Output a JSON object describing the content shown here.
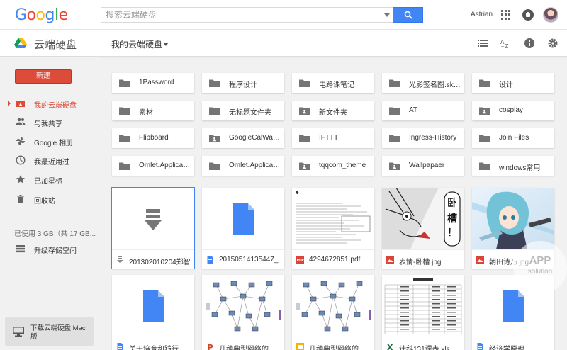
{
  "header": {
    "logo_letters": [
      {
        "ch": "G",
        "color": "#4285f4"
      },
      {
        "ch": "o",
        "color": "#ea4335"
      },
      {
        "ch": "o",
        "color": "#fbbc05"
      },
      {
        "ch": "g",
        "color": "#4285f4"
      },
      {
        "ch": "l",
        "color": "#34a853"
      },
      {
        "ch": "e",
        "color": "#ea4335"
      }
    ],
    "search_placeholder": "搜索云端硬盘",
    "user_name": "Astrian"
  },
  "subbar": {
    "app_title": "云端硬盘",
    "breadcrumb": "我的云端硬盘"
  },
  "sidebar": {
    "new_label": "新建",
    "items": [
      {
        "label": "我的云端硬盘",
        "icon": "drive-icon",
        "active": true
      },
      {
        "label": "与我共享",
        "icon": "people-icon",
        "active": false
      },
      {
        "label": "Google 相册",
        "icon": "photos-icon",
        "active": false
      },
      {
        "label": "我最近用过",
        "icon": "clock-icon",
        "active": false
      },
      {
        "label": "已加星标",
        "icon": "star-icon",
        "active": false
      },
      {
        "label": "回收站",
        "icon": "trash-icon",
        "active": false
      }
    ],
    "storage": "已使用 3 GB（共 17 GB...",
    "upgrade_label": "升级存储空间",
    "download_label": "下载云端硬盘 Mac 版"
  },
  "folders": [
    {
      "name": "1Password",
      "shared": false
    },
    {
      "name": "程序设计",
      "shared": false
    },
    {
      "name": "电路课笔记",
      "shared": false
    },
    {
      "name": "光影签名图.sketch",
      "shared": false
    },
    {
      "name": "设计",
      "shared": false
    },
    {
      "name": "素材",
      "shared": false
    },
    {
      "name": "无标题文件夹",
      "shared": false
    },
    {
      "name": "新文件夹",
      "shared": true
    },
    {
      "name": "AT",
      "shared": false
    },
    {
      "name": "cosplay",
      "shared": true
    },
    {
      "name": "Flipboard",
      "shared": false
    },
    {
      "name": "GoogleCalWallpaper",
      "shared": true
    },
    {
      "name": "IFTTT",
      "shared": false
    },
    {
      "name": "Ingress-History",
      "shared": false
    },
    {
      "name": "Join Files",
      "shared": false
    },
    {
      "name": "Omlet.Application",
      "shared": false
    },
    {
      "name": "Omlet.Application",
      "shared": false
    },
    {
      "name": "tqqcom_theme",
      "shared": true
    },
    {
      "name": "Wallpapaer",
      "shared": true
    },
    {
      "name": "windows常用",
      "shared": false
    }
  ],
  "files": [
    {
      "name": "201302010204郑智",
      "type": "download"
    },
    {
      "name": "20150514135447_",
      "type": "doc"
    },
    {
      "name": "4294672851.pdf",
      "type": "pdf"
    },
    {
      "name": "表情-卧槽.jpg",
      "type": "image",
      "thumb_text": "卧槽！"
    },
    {
      "name": "朝田诗乃.jpg",
      "type": "image"
    },
    {
      "name": "关于培育和践行社会",
      "type": "doc"
    },
    {
      "name": "几种典型网络的拓扑",
      "type": "ppt"
    },
    {
      "name": "几种典型网络的拓扑",
      "type": "slides"
    },
    {
      "name": "计科131课表.xls",
      "type": "sheet"
    },
    {
      "name": "经济学原理",
      "type": "doc"
    }
  ],
  "watermark": {
    "big": "APP",
    "small": "solution"
  }
}
